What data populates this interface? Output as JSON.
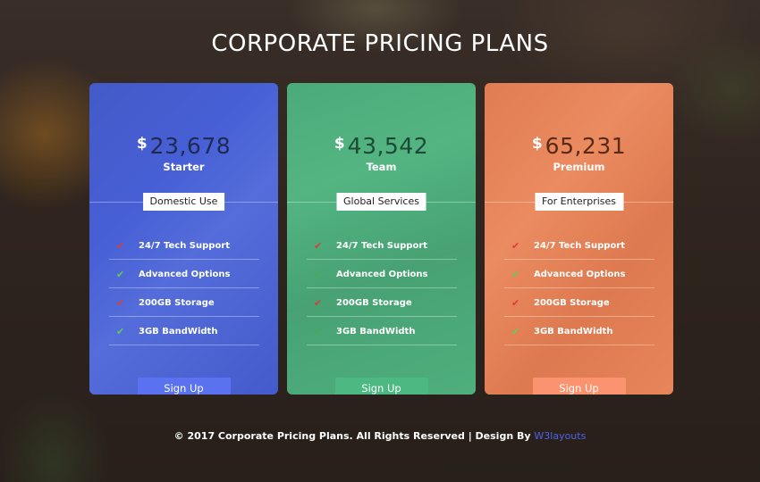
{
  "page": {
    "title": "CORPORATE PRICING PLANS"
  },
  "plans": [
    {
      "currency": "$",
      "amount": "23,678",
      "name": "Starter",
      "tag": "Domestic Use",
      "tint": "#4c66e0",
      "button_color": "#5b72f0",
      "features": [
        {
          "label": "24/7 Tech Support",
          "icon": "red-check-icon",
          "icon_color": "#e03a3a"
        },
        {
          "label": "Advanced Options",
          "icon": "green-check-icon",
          "icon_color": "#5ad05a"
        },
        {
          "label": "200GB Storage",
          "icon": "red-check-icon",
          "icon_color": "#e03a3a"
        },
        {
          "label": "3GB BandWidth",
          "icon": "green-check-icon",
          "icon_color": "#5ad05a"
        }
      ],
      "button_label": "Sign Up"
    },
    {
      "currency": "$",
      "amount": "43,542",
      "name": "Team",
      "tag": "Global Services",
      "tint": "#58c48c",
      "button_color": "#4cb882",
      "features": [
        {
          "label": "24/7 Tech Support",
          "icon": "red-check-icon",
          "icon_color": "#e03a3a"
        },
        {
          "label": "Advanced Options",
          "icon": "green-check-icon",
          "icon_color": "#3fb04a"
        },
        {
          "label": "200GB Storage",
          "icon": "red-check-icon",
          "icon_color": "#e03a3a"
        },
        {
          "label": "3GB BandWidth",
          "icon": "green-check-icon",
          "icon_color": "#3fb04a"
        }
      ],
      "button_label": "Sign Up"
    },
    {
      "currency": "$",
      "amount": "65,231",
      "name": "Premium",
      "tag": "For Enterprises",
      "tint": "#ee855a",
      "button_color": "#fb9370",
      "features": [
        {
          "label": "24/7 Tech Support",
          "icon": "red-check-icon",
          "icon_color": "#e03a3a"
        },
        {
          "label": "Advanced Options",
          "icon": "green-check-icon",
          "icon_color": "#5ad05a"
        },
        {
          "label": "200GB Storage",
          "icon": "red-check-icon",
          "icon_color": "#e03a3a"
        },
        {
          "label": "3GB BandWidth",
          "icon": "green-check-icon",
          "icon_color": "#5ad05a"
        }
      ],
      "button_label": "Sign Up"
    }
  ],
  "footer": {
    "text": "© 2017 Corporate Pricing Plans. All Rights Reserved | Design By",
    "link_label": "W3layouts"
  }
}
